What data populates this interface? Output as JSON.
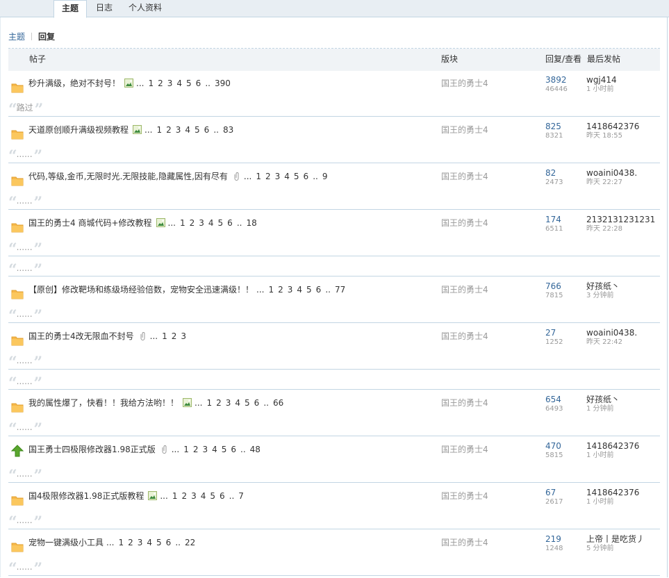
{
  "tabs": [
    {
      "label": "主题",
      "active": true
    },
    {
      "label": "日志",
      "active": false
    },
    {
      "label": "个人资料",
      "active": false
    }
  ],
  "subnav": {
    "topics": "主题",
    "replies": "回复"
  },
  "header": {
    "post": "帖子",
    "forum": "版块",
    "stats": "回复/查看",
    "last": "最后发帖"
  },
  "colors": {
    "link": "#336699",
    "muted": "#999999",
    "border": "#c2d5e3",
    "header_bg": "#f0f3f6"
  },
  "rows": [
    {
      "title": "秒升满级，绝对不封号！",
      "attach": "image-attachment-icon",
      "pages": [
        "1",
        "2",
        "3",
        "4",
        "5",
        "6",
        "..",
        "390"
      ],
      "forum": "国王的勇士4",
      "replies": "3892",
      "views": "46446",
      "last_user": "wgj414",
      "last_time": "1 小时前",
      "quote": "路过",
      "icon": "folder-icon"
    },
    {
      "title": "天道原创顺升满级视频教程",
      "attach": "image-attachment-icon",
      "pages": [
        "1",
        "2",
        "3",
        "4",
        "5",
        "6",
        "..",
        "83"
      ],
      "forum": "国王的勇士4",
      "replies": "825",
      "views": "8321",
      "last_user": "1418642376",
      "last_time": "昨天 18:55",
      "quote": "......",
      "icon": "folder-icon"
    },
    {
      "title": "代码,等级,金币,无限时光.无限技能,隐藏属性,因有尽有",
      "attach": "paperclip-icon",
      "pages": [
        "1",
        "2",
        "3",
        "4",
        "5",
        "6",
        "..",
        "9"
      ],
      "forum": "国王的勇士4",
      "replies": "82",
      "views": "2473",
      "last_user": "woaini0438.",
      "last_time": "昨天 22:27",
      "quote": "......",
      "icon": "folder-icon"
    },
    {
      "title": "国王的勇士4 商城代码+修改教程",
      "attach": "image-attachment-icon",
      "pages": [
        "1",
        "2",
        "3",
        "4",
        "5",
        "6",
        "..",
        "18"
      ],
      "forum": "国王的勇士4",
      "replies": "174",
      "views": "6511",
      "last_user": "2132131231231",
      "last_time": "昨天 22:28",
      "quote": "......",
      "icon": "folder-icon"
    },
    {
      "title": "【原创】修改靶场和练级场经验倍数，宠物安全迅速满级！！",
      "attach": "",
      "pages": [
        "1",
        "2",
        "3",
        "4",
        "5",
        "6",
        "..",
        "77"
      ],
      "forum": "国王的勇士4",
      "replies": "766",
      "views": "7815",
      "last_user": "好孩纸丶",
      "last_time": "3 分钟前",
      "quote": "......",
      "icon": "folder-icon"
    },
    {
      "title": "国王的勇士4改无限血不封号",
      "attach": "paperclip-icon",
      "pages": [
        "1",
        "2",
        "3"
      ],
      "forum": "国王的勇士4",
      "replies": "27",
      "views": "1252",
      "last_user": "woaini0438.",
      "last_time": "昨天 22:42",
      "quote": "......",
      "icon": "folder-icon"
    },
    {
      "title": "我的属性爆了，快看！！我给方法哟！！",
      "attach": "image-attachment-icon",
      "pages": [
        "1",
        "2",
        "3",
        "4",
        "5",
        "6",
        "..",
        "66"
      ],
      "forum": "国王的勇士4",
      "replies": "654",
      "views": "6493",
      "last_user": "好孩纸丶",
      "last_time": "1 分钟前",
      "quote": "......",
      "icon": "folder-icon"
    },
    {
      "title": "国王勇士四极限修改器1.98正式版",
      "attach": "paperclip-icon",
      "pages": [
        "1",
        "2",
        "3",
        "4",
        "5",
        "6",
        "..",
        "48"
      ],
      "forum": "国王的勇士4",
      "replies": "470",
      "views": "5815",
      "last_user": "1418642376",
      "last_time": "1 小时前",
      "quote": "......",
      "icon": "up-arrow-icon"
    },
    {
      "title": "国4极限修改器1.98正式版教程",
      "attach": "image-attachment-icon",
      "pages": [
        "1",
        "2",
        "3",
        "4",
        "5",
        "6",
        "..",
        "7"
      ],
      "forum": "国王的勇士4",
      "replies": "67",
      "views": "2617",
      "last_user": "1418642376",
      "last_time": "1 小时前",
      "quote": "......",
      "icon": "folder-icon"
    },
    {
      "title": "宠物一键满级小工具",
      "attach": "",
      "pages": [
        "1",
        "2",
        "3",
        "4",
        "5",
        "6",
        "..",
        "22"
      ],
      "forum": "国王的勇士4",
      "replies": "219",
      "views": "1248",
      "last_user": "上帝丨是吃货丿",
      "last_time": "5 分钟前",
      "quote": "......",
      "icon": "folder-icon"
    }
  ],
  "extra_quotes": [
    "......",
    "......"
  ]
}
